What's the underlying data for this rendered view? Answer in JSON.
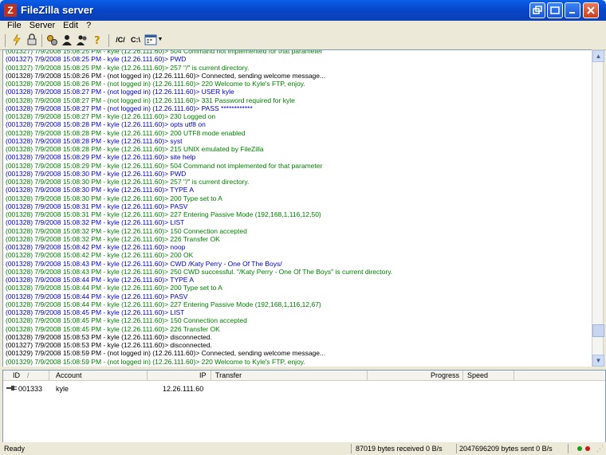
{
  "window": {
    "title": "FileZilla server",
    "app_icon": "Z",
    "buttons": [
      "restore-icon",
      "minimize-icon",
      "maximize-icon",
      "close-icon"
    ]
  },
  "menu": [
    "File",
    "Server",
    "Edit",
    "?"
  ],
  "toolbar": {
    "path_c_label": "/C/",
    "path_drive_label": "C:\\"
  },
  "colors": {
    "blue": "#0000cc",
    "green": "#008000",
    "black": "#000000"
  },
  "log": [
    {
      "text": "(001327) 7/9/2008 15:08:25 PM - kyle (12.26.111.60)> 504 Command not implemented for that parameter",
      "color": "green"
    },
    {
      "text": "(001327) 7/9/2008 15:08:25 PM - kyle (12.26.111.60)> PWD",
      "color": "blue"
    },
    {
      "text": "(001327) 7/9/2008 15:08:25 PM - kyle (12.26.111.60)> 257 \"/\" is current directory.",
      "color": "green"
    },
    {
      "text": "(001328) 7/9/2008 15:08:26 PM - (not logged in) (12.26.111.60)> Connected, sending welcome message...",
      "color": "black"
    },
    {
      "text": "(001328) 7/9/2008 15:08:26 PM - (not logged in) (12.26.111.60)> 220 Welcome to Kyle's FTP, enjoy.",
      "color": "green"
    },
    {
      "text": "(001328) 7/9/2008 15:08:27 PM - (not logged in) (12.26.111.60)> USER kyle",
      "color": "blue"
    },
    {
      "text": "(001328) 7/9/2008 15:08:27 PM - (not logged in) (12.26.111.60)> 331 Password required for kyle",
      "color": "green"
    },
    {
      "text": "(001328) 7/9/2008 15:08:27 PM - (not logged in) (12.26.111.60)> PASS ************",
      "color": "blue"
    },
    {
      "text": "(001328) 7/9/2008 15:08:27 PM - kyle (12.26.111.60)> 230 Logged on",
      "color": "green"
    },
    {
      "text": "(001328) 7/9/2008 15:08:28 PM - kyle (12.26.111.60)> opts utf8 on",
      "color": "blue"
    },
    {
      "text": "(001328) 7/9/2008 15:08:28 PM - kyle (12.26.111.60)> 200 UTF8 mode enabled",
      "color": "green"
    },
    {
      "text": "(001328) 7/9/2008 15:08:28 PM - kyle (12.26.111.60)> syst",
      "color": "blue"
    },
    {
      "text": "(001328) 7/9/2008 15:08:28 PM - kyle (12.26.111.60)> 215 UNIX emulated by FileZilla",
      "color": "green"
    },
    {
      "text": "(001328) 7/9/2008 15:08:29 PM - kyle (12.26.111.60)> site help",
      "color": "blue"
    },
    {
      "text": "(001328) 7/9/2008 15:08:29 PM - kyle (12.26.111.60)> 504 Command not implemented for that parameter",
      "color": "green"
    },
    {
      "text": "(001328) 7/9/2008 15:08:30 PM - kyle (12.26.111.60)> PWD",
      "color": "blue"
    },
    {
      "text": "(001328) 7/9/2008 15:08:30 PM - kyle (12.26.111.60)> 257 \"/\" is current directory.",
      "color": "green"
    },
    {
      "text": "(001328) 7/9/2008 15:08:30 PM - kyle (12.26.111.60)> TYPE A",
      "color": "blue"
    },
    {
      "text": "(001328) 7/9/2008 15:08:30 PM - kyle (12.26.111.60)> 200 Type set to A",
      "color": "green"
    },
    {
      "text": "(001328) 7/9/2008 15:08:31 PM - kyle (12.26.111.60)> PASV",
      "color": "blue"
    },
    {
      "text": "(001328) 7/9/2008 15:08:31 PM - kyle (12.26.111.60)> 227 Entering Passive Mode (192,168,1,116,12,50)",
      "color": "green"
    },
    {
      "text": "(001328) 7/9/2008 15:08:32 PM - kyle (12.26.111.60)> LIST",
      "color": "blue"
    },
    {
      "text": "(001328) 7/9/2008 15:08:32 PM - kyle (12.26.111.60)> 150 Connection accepted",
      "color": "green"
    },
    {
      "text": "(001328) 7/9/2008 15:08:32 PM - kyle (12.26.111.60)> 226 Transfer OK",
      "color": "green"
    },
    {
      "text": "(001328) 7/9/2008 15:08:42 PM - kyle (12.26.111.60)> noop",
      "color": "blue"
    },
    {
      "text": "(001328) 7/9/2008 15:08:42 PM - kyle (12.26.111.60)> 200 OK",
      "color": "green"
    },
    {
      "text": "(001328) 7/9/2008 15:08:43 PM - kyle (12.26.111.60)> CWD /Katy Perry - One Of The Boys/",
      "color": "blue"
    },
    {
      "text": "(001328) 7/9/2008 15:08:43 PM - kyle (12.26.111.60)> 250 CWD successful. \"/Katy Perry - One Of The Boys\" is current directory.",
      "color": "green"
    },
    {
      "text": "(001328) 7/9/2008 15:08:44 PM - kyle (12.26.111.60)> TYPE A",
      "color": "blue"
    },
    {
      "text": "(001328) 7/9/2008 15:08:44 PM - kyle (12.26.111.60)> 200 Type set to A",
      "color": "green"
    },
    {
      "text": "(001328) 7/9/2008 15:08:44 PM - kyle (12.26.111.60)> PASV",
      "color": "blue"
    },
    {
      "text": "(001328) 7/9/2008 15:08:44 PM - kyle (12.26.111.60)> 227 Entering Passive Mode (192,168,1,116,12,67)",
      "color": "green"
    },
    {
      "text": "(001328) 7/9/2008 15:08:45 PM - kyle (12.26.111.60)> LIST",
      "color": "blue"
    },
    {
      "text": "(001328) 7/9/2008 15:08:45 PM - kyle (12.26.111.60)> 150 Connection accepted",
      "color": "green"
    },
    {
      "text": "(001328) 7/9/2008 15:08:45 PM - kyle (12.26.111.60)> 226 Transfer OK",
      "color": "green"
    },
    {
      "text": "(001328) 7/9/2008 15:08:53 PM - kyle (12.26.111.60)> disconnected.",
      "color": "black"
    },
    {
      "text": "(001327) 7/9/2008 15:08:53 PM - kyle (12.26.111.60)> disconnected.",
      "color": "black"
    },
    {
      "text": "(001329) 7/9/2008 15:08:59 PM - (not logged in) (12.26.111.60)> Connected, sending welcome message...",
      "color": "black"
    },
    {
      "text": "(001329) 7/9/2008 15:08:59 PM - (not logged in) (12.26.111.60)> 220 Welcome to Kyle's FTP, enjoy.",
      "color": "green"
    }
  ],
  "sessions": {
    "headers": {
      "id": "ID",
      "sort_arrow": "/",
      "account": "Account",
      "ip": "IP",
      "transfer": "Transfer",
      "progress": "Progress",
      "speed": "Speed"
    },
    "rows": [
      {
        "id": "001333",
        "account": "kyle",
        "ip": "12.26.111.60",
        "transfer": "",
        "progress": "",
        "speed": ""
      }
    ]
  },
  "status": {
    "ready": "Ready",
    "received": "87019 bytes received  0 B/s",
    "sent": "2047696209 bytes sent  0 B/s"
  }
}
